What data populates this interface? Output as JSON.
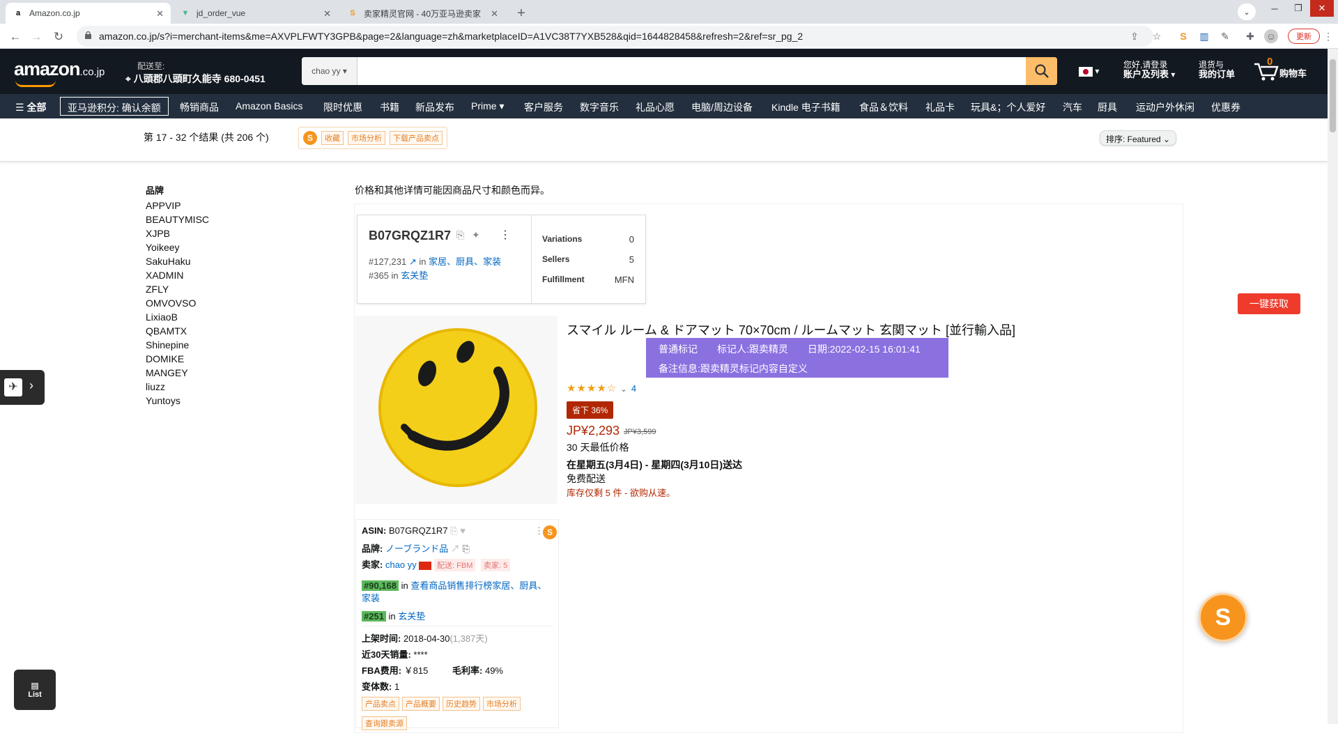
{
  "browser": {
    "tabs": [
      {
        "title": "Amazon.co.jp",
        "icon": "amazon-favicon"
      },
      {
        "title": "jd_order_vue",
        "icon": "vue-favicon"
      },
      {
        "title": "卖家精灵官网 - 40万亚马逊卖家",
        "icon": "sellersprite-favicon"
      }
    ],
    "url": "amazon.co.jp/s?i=merchant-items&me=AXVPLFWTY3GPB&page=2&language=zh&marketplaceID=A1VC38T7YXB528&qid=1644828458&refresh=2&ref=sr_pg_2",
    "update_label": "更新"
  },
  "header": {
    "logo": "amazon",
    "logo_suffix": ".co.jp",
    "deliver_label": "配送至:",
    "deliver_address": "八頭郡八頭町久能寺 680-0451",
    "search_dept": "chao yy",
    "account_line1": "您好,请登录",
    "account_line2": "账户及列表",
    "orders_line1": "退货与",
    "orders_line2": "我的订单",
    "cart_count": "0",
    "cart_label": "购物车"
  },
  "nav": {
    "all": "全部",
    "boxed": "亚马逊积分: 确认余额",
    "items": [
      "畅销商品",
      "Amazon Basics",
      "限时优惠",
      "书籍",
      "新品发布",
      "Prime",
      "客户服务",
      "数字音乐",
      "礼品心愿",
      "电脑/周边设备",
      "Kindle 电子书籍",
      "食品＆饮料",
      "礼品卡",
      "玩具&；个人爱好",
      "汽车",
      "厨具",
      "运动户外休闲",
      "优惠券"
    ]
  },
  "subbar": {
    "results": "第 17 - 32 个结果 (共 206 个)",
    "chips": [
      "收藏",
      "市场分析",
      "下载产品卖点"
    ],
    "sort": "排序: Featured"
  },
  "sidebar": {
    "title": "品牌",
    "brands": [
      "APPVIP",
      "BEAUTYMISC",
      "XJPB",
      "Yoikeey",
      "SakuHaku",
      "XADMIN",
      "ZFLY",
      "OMVOVSO",
      "LixiaoB",
      "QBAMTX",
      "Shinepine",
      "DOMIKE",
      "MANGEY",
      "liuzz",
      "Yuntoys"
    ]
  },
  "main": {
    "disclaimer": "价格和其他详情可能因商品尺寸和颜色而异。",
    "asin_pop": {
      "asin": "B07GRQZ1R7",
      "rank1": "#127,231",
      "in": "in",
      "cat1": "家居、厨具、家装",
      "rank2": "#365",
      "cat2": "玄关垫",
      "variations_label": "Variations",
      "variations": "0",
      "sellers_label": "Sellers",
      "sellers": "5",
      "fulfillment_label": "Fulfillment",
      "fulfillment": "MFN"
    },
    "product": {
      "title": "スマイル ルーム & ドアマット 70×70cm / ルームマット 玄関マット [並行輸入品]",
      "tag_line1": "普通标记　　标记人:跟卖精灵　　日期:2022-02-15 16:01:41",
      "tag_line2": "备注信息:跟卖精灵标记内容自定义",
      "rating": 3.5,
      "stars": "★★★★☆",
      "rating_count": "4",
      "save": "省下 36%",
      "price": "JP¥2,293",
      "old_price": "JP¥3,599",
      "lowest": "30 天最低价格",
      "delivery": "在星期五(3月4日) - 星期四(3月10日)送达",
      "free": "免费配送",
      "stock": "库存仅剩 5 件 - 欲购从速。"
    },
    "panel": {
      "asin_label": "ASIN:",
      "asin": "B07GRQZ1R7",
      "brand_label": "品牌:",
      "brand": "ノーブランド品",
      "seller_label": "卖家:",
      "seller": "chao yy",
      "fbm": "配送: FBM",
      "sellers": "卖家: 5",
      "bsr1": "#90,168",
      "bsr1_text": "查看商品销售排行榜家居、厨具、家装",
      "bsr2": "#251",
      "bsr2_text": "玄关垫",
      "in": "in",
      "listed_label": "上架时间:",
      "listed": "2018-04-30",
      "listed_days": "(1,387天)",
      "sales_label": "近30天销量:",
      "sales": "****",
      "fba_label": "FBA费用:",
      "fba": "￥815",
      "margin_label": "毛利率:",
      "margin": "49%",
      "variants_label": "变体数:",
      "variants": "1",
      "chips": [
        "产品卖点",
        "产品概要",
        "历史趋势",
        "市场分析"
      ],
      "chip_extra": "查询跟卖源"
    },
    "grab_button": "一键获取",
    "list_button": "List"
  },
  "colors": {
    "amazon_dark": "#131921",
    "amazon_nav": "#232f3e",
    "search_btn": "#febd69",
    "tag_purple": "#8b70e0",
    "price_red": "#b12704",
    "sellersprite_orange": "#f7941d"
  }
}
